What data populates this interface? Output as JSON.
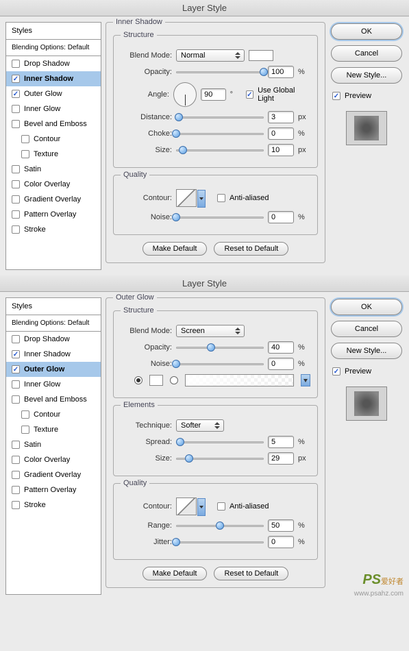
{
  "dialogs": [
    {
      "title": "Layer Style",
      "styles_header": "Styles",
      "blending": "Blending Options: Default",
      "styles": [
        {
          "label": "Drop Shadow",
          "checked": false,
          "selected": false,
          "indent": false
        },
        {
          "label": "Inner Shadow",
          "checked": true,
          "selected": true,
          "indent": false
        },
        {
          "label": "Outer Glow",
          "checked": true,
          "selected": false,
          "indent": false
        },
        {
          "label": "Inner Glow",
          "checked": false,
          "selected": false,
          "indent": false
        },
        {
          "label": "Bevel and Emboss",
          "checked": false,
          "selected": false,
          "indent": false
        },
        {
          "label": "Contour",
          "checked": false,
          "selected": false,
          "indent": true
        },
        {
          "label": "Texture",
          "checked": false,
          "selected": false,
          "indent": true
        },
        {
          "label": "Satin",
          "checked": false,
          "selected": false,
          "indent": false
        },
        {
          "label": "Color Overlay",
          "checked": false,
          "selected": false,
          "indent": false
        },
        {
          "label": "Gradient Overlay",
          "checked": false,
          "selected": false,
          "indent": false
        },
        {
          "label": "Pattern Overlay",
          "checked": false,
          "selected": false,
          "indent": false
        },
        {
          "label": "Stroke",
          "checked": false,
          "selected": false,
          "indent": false
        }
      ],
      "panel_title": "Inner Shadow",
      "structure_legend": "Structure",
      "blend_mode_label": "Blend Mode:",
      "blend_mode_value": "Normal",
      "opacity_label": "Opacity:",
      "opacity_value": "100",
      "opacity_unit": "%",
      "angle_label": "Angle:",
      "angle_value": "90",
      "angle_unit": "°",
      "global_light_label": "Use Global Light",
      "distance_label": "Distance:",
      "distance_value": "3",
      "distance_unit": "px",
      "choke_label": "Choke:",
      "choke_value": "0",
      "choke_unit": "%",
      "size_label": "Size:",
      "size_value": "10",
      "size_unit": "px",
      "quality_legend": "Quality",
      "contour_label": "Contour:",
      "antialiased_label": "Anti-aliased",
      "noise_label": "Noise:",
      "noise_value": "0",
      "noise_unit": "%",
      "make_default": "Make Default",
      "reset_default": "Reset to Default",
      "ok": "OK",
      "cancel": "Cancel",
      "new_style": "New Style...",
      "preview": "Preview"
    },
    {
      "title": "Layer Style",
      "styles_header": "Styles",
      "blending": "Blending Options: Default",
      "styles": [
        {
          "label": "Drop Shadow",
          "checked": false,
          "selected": false,
          "indent": false
        },
        {
          "label": "Inner Shadow",
          "checked": true,
          "selected": false,
          "indent": false
        },
        {
          "label": "Outer Glow",
          "checked": true,
          "selected": true,
          "indent": false
        },
        {
          "label": "Inner Glow",
          "checked": false,
          "selected": false,
          "indent": false
        },
        {
          "label": "Bevel and Emboss",
          "checked": false,
          "selected": false,
          "indent": false
        },
        {
          "label": "Contour",
          "checked": false,
          "selected": false,
          "indent": true
        },
        {
          "label": "Texture",
          "checked": false,
          "selected": false,
          "indent": true
        },
        {
          "label": "Satin",
          "checked": false,
          "selected": false,
          "indent": false
        },
        {
          "label": "Color Overlay",
          "checked": false,
          "selected": false,
          "indent": false
        },
        {
          "label": "Gradient Overlay",
          "checked": false,
          "selected": false,
          "indent": false
        },
        {
          "label": "Pattern Overlay",
          "checked": false,
          "selected": false,
          "indent": false
        },
        {
          "label": "Stroke",
          "checked": false,
          "selected": false,
          "indent": false
        }
      ],
      "panel_title": "Outer Glow",
      "structure_legend": "Structure",
      "blend_mode_label": "Blend Mode:",
      "blend_mode_value": "Screen",
      "opacity_label": "Opacity:",
      "opacity_value": "40",
      "opacity_unit": "%",
      "noise_label": "Noise:",
      "noise_value": "0",
      "noise_unit": "%",
      "elements_legend": "Elements",
      "technique_label": "Technique:",
      "technique_value": "Softer",
      "spread_label": "Spread:",
      "spread_value": "5",
      "spread_unit": "%",
      "size_label": "Size:",
      "size_value": "29",
      "size_unit": "px",
      "quality_legend": "Quality",
      "contour_label": "Contour:",
      "antialiased_label": "Anti-aliased",
      "range_label": "Range:",
      "range_value": "50",
      "range_unit": "%",
      "jitter_label": "Jitter:",
      "jitter_value": "0",
      "jitter_unit": "%",
      "make_default": "Make Default",
      "reset_default": "Reset to Default",
      "ok": "OK",
      "cancel": "Cancel",
      "new_style": "New Style...",
      "preview": "Preview"
    }
  ],
  "watermark": {
    "ps": "PS",
    "cn": "爱好者",
    "url": "www.psahz.com"
  }
}
